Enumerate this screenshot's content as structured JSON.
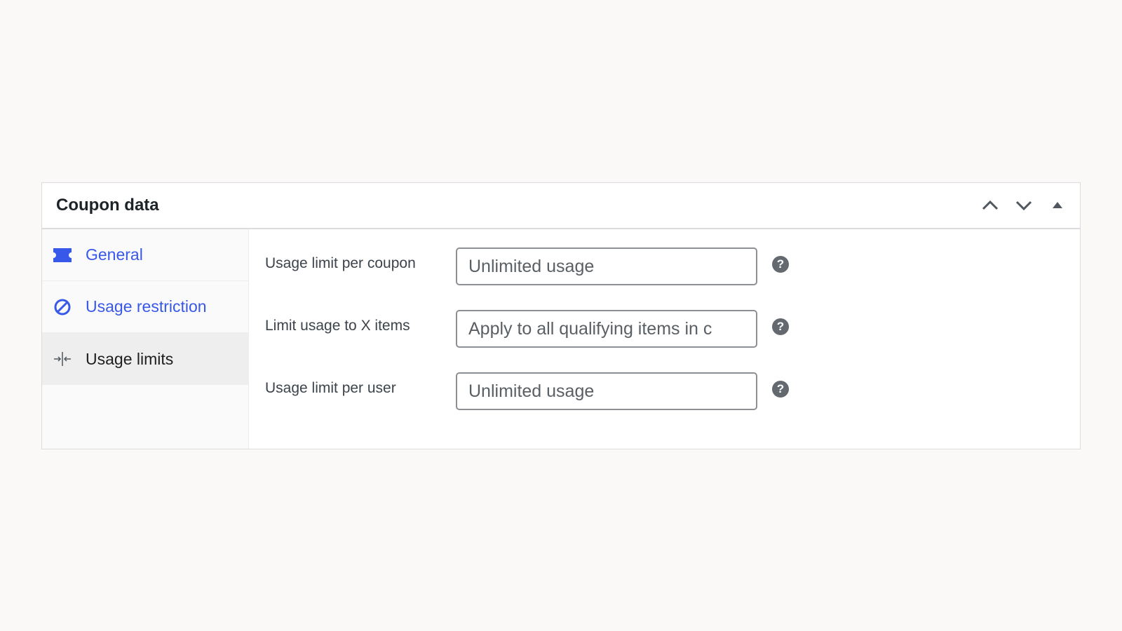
{
  "panel": {
    "title": "Coupon data",
    "controls": [
      {
        "name": "move-up",
        "icon": "chevron-up-icon"
      },
      {
        "name": "move-down",
        "icon": "chevron-down-icon"
      },
      {
        "name": "toggle-panel",
        "icon": "triangle-up-icon"
      }
    ]
  },
  "tabs": [
    {
      "label": "General",
      "icon": "ticket-icon",
      "active": false
    },
    {
      "label": "Usage restriction",
      "icon": "no-entry-icon",
      "active": false
    },
    {
      "label": "Usage limits",
      "icon": "arrows-in-icon",
      "active": true
    }
  ],
  "fields": [
    {
      "label": "Usage limit per coupon",
      "value": "",
      "placeholder": "Unlimited usage",
      "help": "?"
    },
    {
      "label": "Limit usage to X items",
      "value": "",
      "placeholder": "Apply to all qualifying items in c",
      "help": "?"
    },
    {
      "label": "Usage limit per user",
      "value": "",
      "placeholder": "Unlimited usage",
      "help": "?"
    }
  ],
  "colors": {
    "accent": "#3858e9",
    "background": "#faf9f8",
    "help_icon": "#646970"
  }
}
